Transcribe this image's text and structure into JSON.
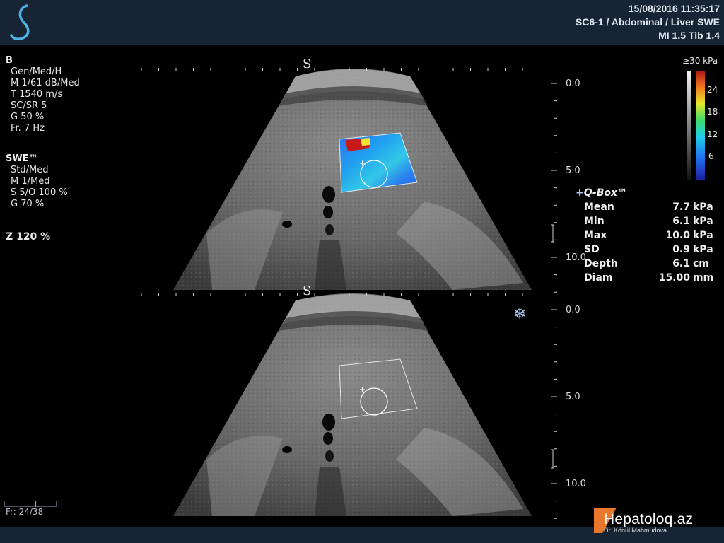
{
  "header": {
    "datetime": "15/08/2016 11:35:17",
    "preset": "SC6-1 / Abdominal / Liver SWE",
    "indices": "MI 1.5  Tib  1.4"
  },
  "bmode": {
    "title": "B",
    "rows": [
      "Gen/Med/H",
      "M 1/61 dB/Med",
      "T 1540 m/s",
      "SC/SR 5",
      "G 50 %",
      "Fr. 7 Hz"
    ]
  },
  "swe": {
    "title": "SWE™",
    "rows": [
      "Std/Med",
      "M 1/Med",
      "S 5/O 100 %",
      "G 70 %"
    ]
  },
  "zoom": "Z  120  %",
  "frame_counter": "Fr: 24/38",
  "frame_progress": 0.6,
  "depth_top": [
    "0.0",
    "5.0",
    "10.0"
  ],
  "depth_bottom": [
    "0.0",
    "5.0",
    "10.0"
  ],
  "colorbar": {
    "max_label": "≥30 kPa",
    "ticks": [
      "24",
      "18",
      "12",
      "6"
    ]
  },
  "qbox": {
    "title": "Q-Box™",
    "plus": "+",
    "rows": [
      {
        "label": "Mean",
        "value": "7.7",
        "unit": "kPa"
      },
      {
        "label": "Min",
        "value": "6.1",
        "unit": "kPa"
      },
      {
        "label": "Max",
        "value": "10.0",
        "unit": "kPa"
      },
      {
        "label": "SD",
        "value": "0.9",
        "unit": "kPa"
      },
      {
        "label": "Depth",
        "value": "6.1",
        "unit": "cm"
      },
      {
        "label": "Diam",
        "value": "15.00",
        "unit": "mm"
      }
    ]
  },
  "freeze_icon": "snowflake-icon",
  "watermark": {
    "brand": "Hepatoloq.az",
    "author": "Dr. Könül Mahmudova"
  },
  "colors": {
    "topbar": "#172433",
    "accent": "#e8782c"
  }
}
